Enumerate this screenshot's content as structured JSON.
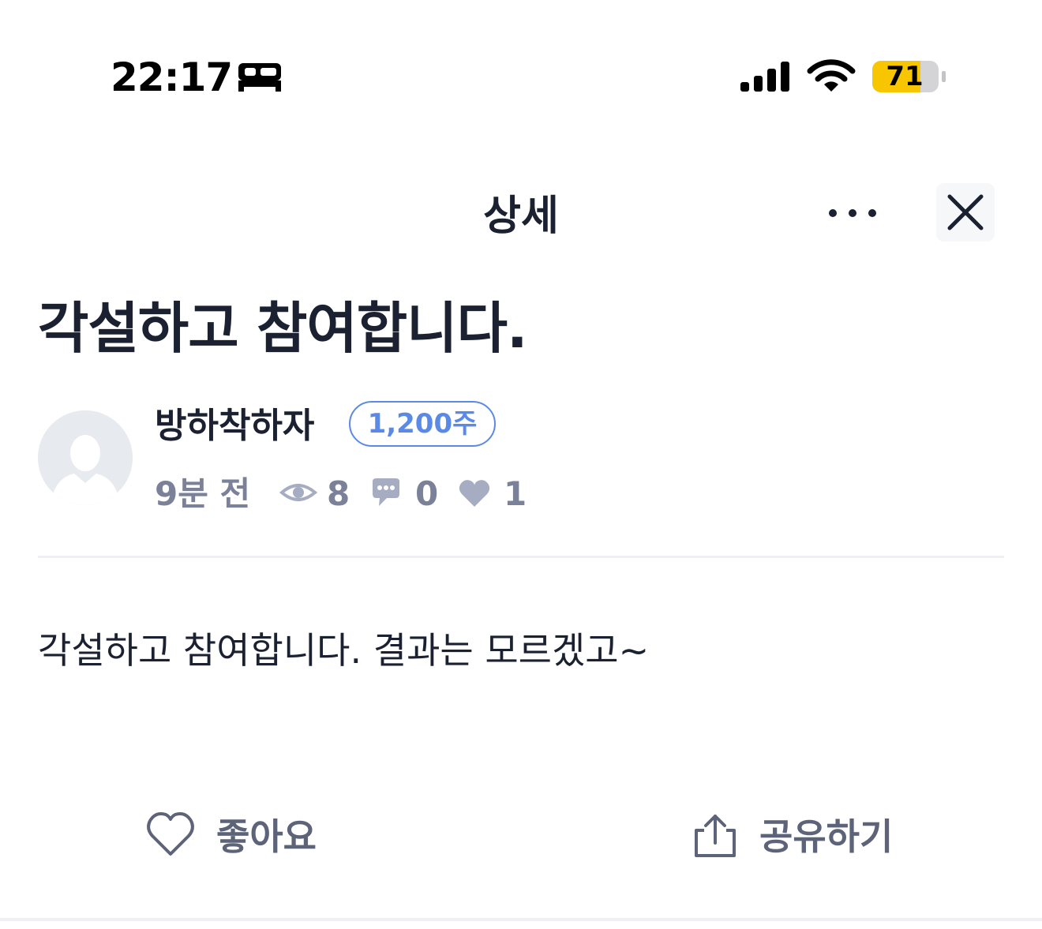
{
  "status_bar": {
    "time": "22:17",
    "sleep_icon": "bed-icon",
    "signal_icon": "cellular-signal-icon",
    "wifi_icon": "wifi-icon",
    "battery_level": "71",
    "battery_color": "#f7c600"
  },
  "header": {
    "title": "상세",
    "more_icon": "more-horizontal-icon",
    "close_icon": "close-icon"
  },
  "post": {
    "title": "각설하고 참여합니다.",
    "author": {
      "name": "방하착하자",
      "shares_badge": "1,200주",
      "avatar_icon": "default-avatar-icon"
    },
    "meta": {
      "time_ago": "9분 전",
      "views": "8",
      "comments": "0",
      "likes": "1"
    },
    "body": "각설하고 참여합니다. 결과는 모르겠고~"
  },
  "actions": {
    "like_label": "좋아요",
    "share_label": "공유하기"
  },
  "colors": {
    "accent_badge": "#5b8ae6",
    "meta_gray": "#7a8198",
    "title_text": "#1b2131"
  }
}
